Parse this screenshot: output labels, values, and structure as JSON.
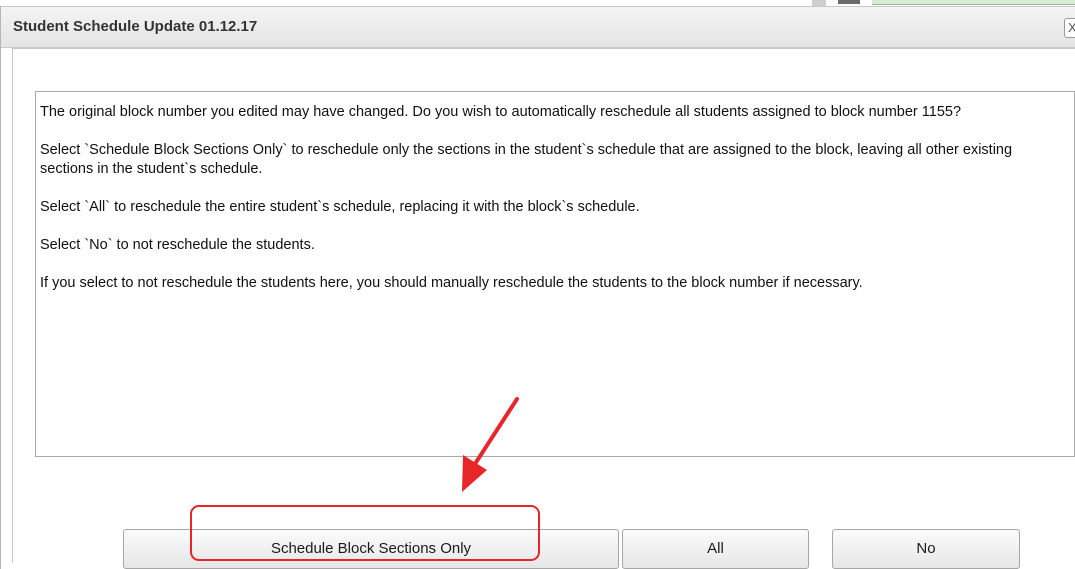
{
  "dialog": {
    "title": "Student Schedule Update 01.12.17",
    "close_glyph": "X"
  },
  "message": {
    "paragraphs": [
      "The original block number you edited may have changed.  Do you wish to automatically reschedule all students assigned to block number 1155?",
      "Select `Schedule Block Sections Only` to reschedule only the sections in the student`s schedule that are assigned to the block, leaving all other existing sections in the student`s schedule.",
      "Select `All` to reschedule the entire student`s schedule, replacing it with the block`s schedule.",
      "Select `No` to not reschedule the students.",
      "If you select to not reschedule the students here, you should manually reschedule the students to the block number if necessary."
    ]
  },
  "buttons": {
    "schedule_block_sections_only": "Schedule Block Sections Only",
    "all": "All",
    "no": "No"
  },
  "annotation": {
    "color": "#e8262a"
  }
}
